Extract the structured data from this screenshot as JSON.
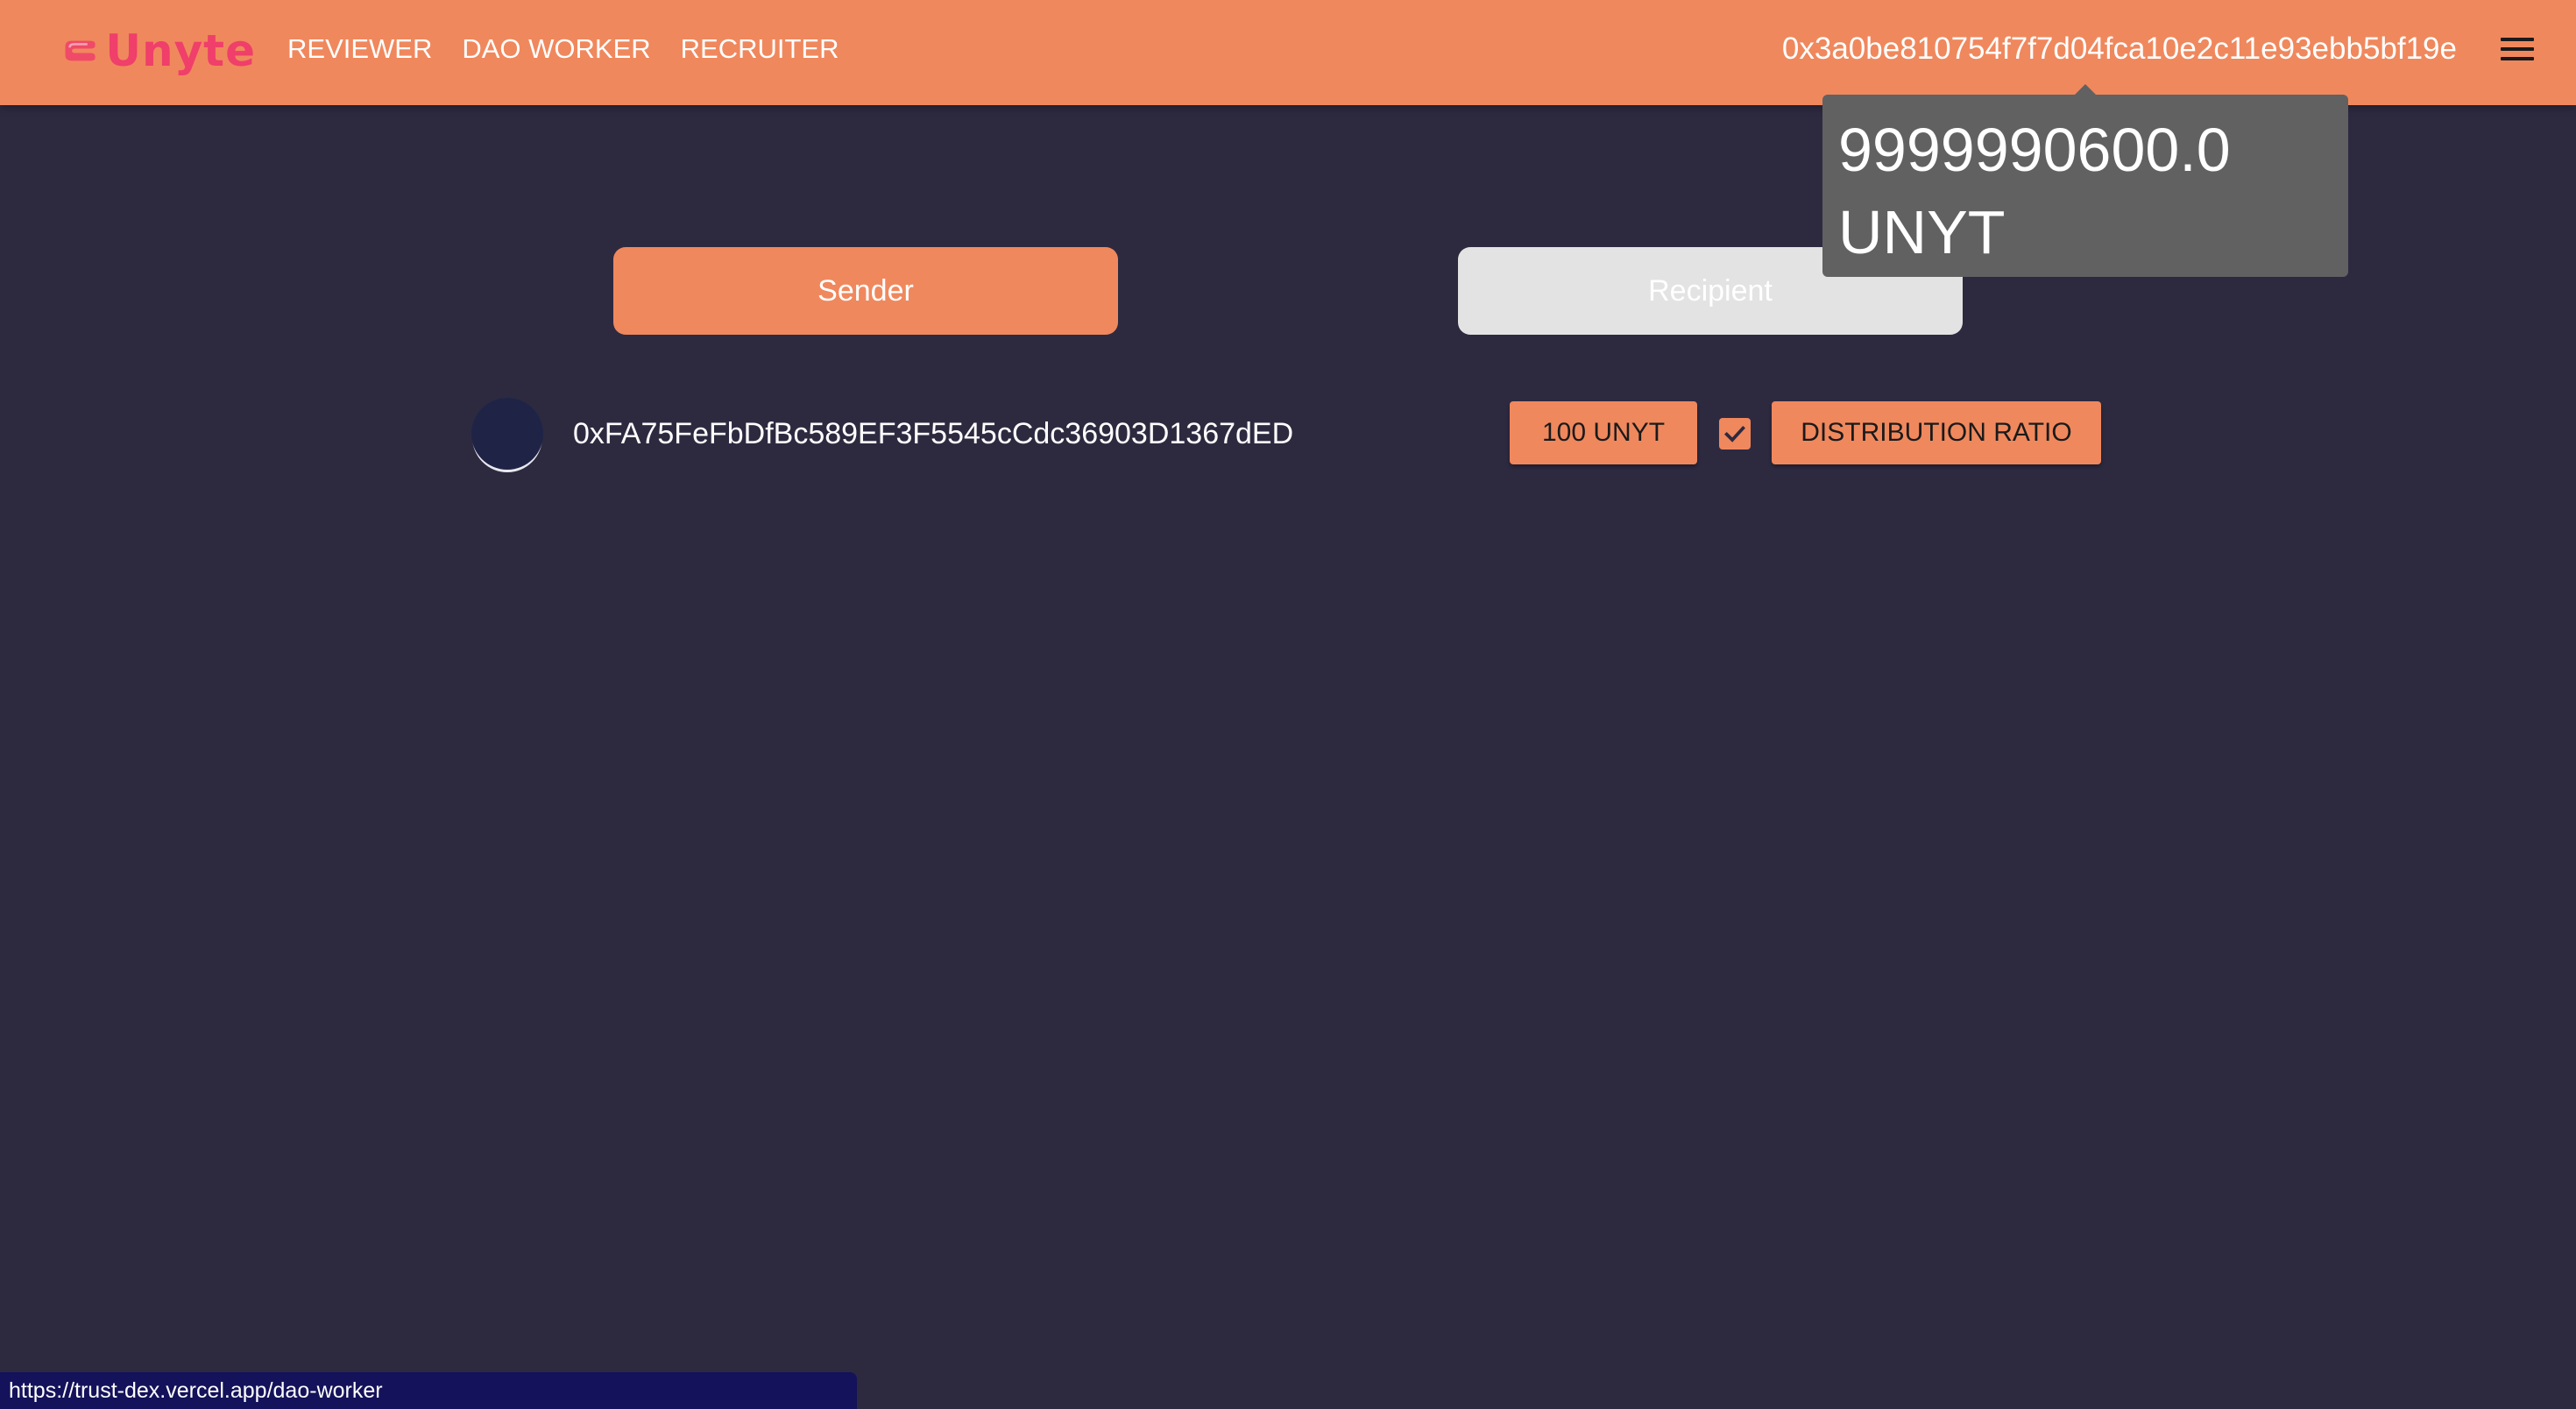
{
  "header": {
    "logo_text": "Unyte",
    "nav": [
      "REVIEWER",
      "DAO WORKER",
      "RECRUITER"
    ],
    "wallet_address": "0x3a0be810754f7f7d04fca10e2c11e93ebb5bf19e",
    "menu_icon": "hamburger-menu-icon"
  },
  "tooltip": {
    "balance": "9999990600.0",
    "unit": "UNYT"
  },
  "toggle": {
    "sender_label": "Sender",
    "recipient_label": "Recipient",
    "active": "Sender"
  },
  "recipient_row": {
    "address": "0xFA75FeFbDfBc589EF3F5545cCdc36903D1367dED",
    "amount_label": "100 UNYT",
    "checked": true,
    "ratio_label": "DISTRIBUTION RATIO"
  },
  "status_bar": {
    "url": "https://trust-dex.vercel.app/dao-worker"
  },
  "colors": {
    "accent": "#f0885d",
    "background": "#2d2a40",
    "logo": "#ef3f6a"
  }
}
